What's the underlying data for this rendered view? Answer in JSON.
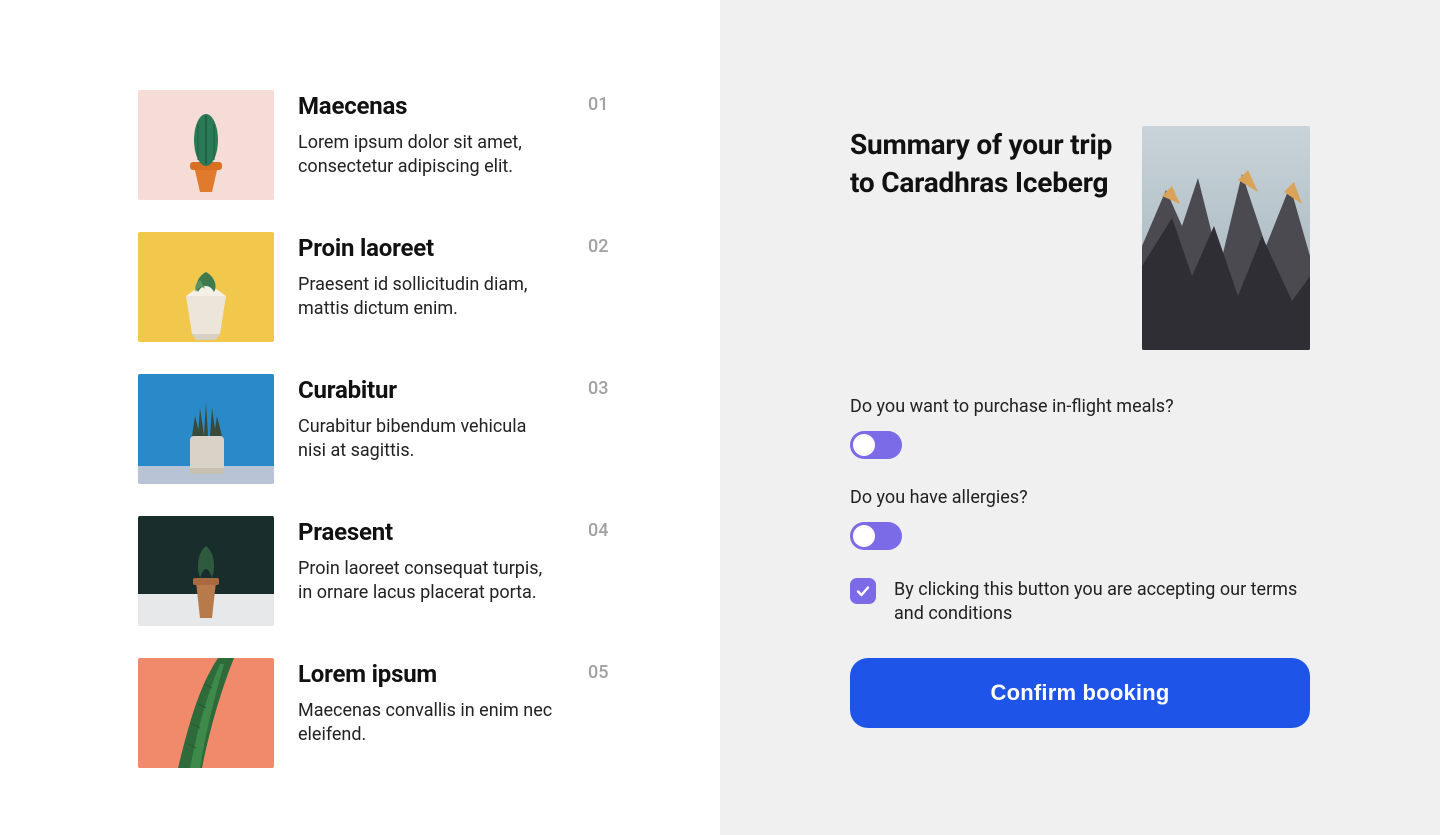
{
  "left": {
    "items": [
      {
        "title": "Maecenas",
        "desc": "Lorem ipsum dolor sit amet, consectetur adipiscing elit.",
        "num": "01"
      },
      {
        "title": "Proin laoreet",
        "desc": "Praesent id sollicitudin diam, mattis dictum enim.",
        "num": "02"
      },
      {
        "title": "Curabitur",
        "desc": "Curabitur bibendum vehicula nisi at sagittis.",
        "num": "03"
      },
      {
        "title": "Praesent",
        "desc": "Proin laoreet consequat turpis, in ornare lacus placerat porta.",
        "num": "04"
      },
      {
        "title": "Lorem ipsum",
        "desc": "Maecenas convallis in enim nec eleifend.",
        "num": "05"
      }
    ]
  },
  "right": {
    "title": "Summary of your trip to Caradhras Iceberg",
    "q1": "Do you want to purchase in-flight meals?",
    "q2": "Do you have allergies?",
    "terms": "By clicking this button you are accepting our terms and conditions",
    "confirm": "Confirm booking"
  }
}
